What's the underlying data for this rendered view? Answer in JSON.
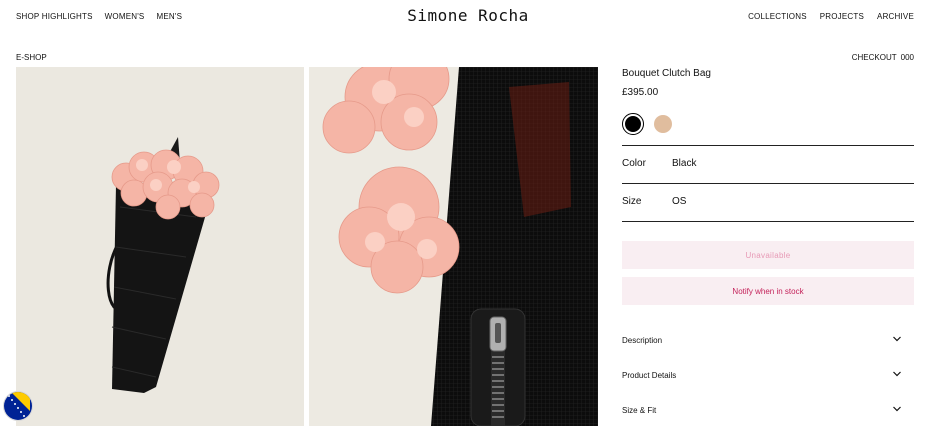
{
  "nav": {
    "left": [
      "SHOP HIGHLIGHTS",
      "WOMEN'S",
      "MEN'S"
    ],
    "brand": "Simone Rocha",
    "right": [
      "COLLECTIONS",
      "PROJECTS",
      "ARCHIVE"
    ]
  },
  "breadcrumb": "E-SHOP",
  "checkout": {
    "label": "CHECKOUT",
    "count": "000"
  },
  "product": {
    "title": "Bouquet Clutch Bag",
    "price": "£395.00",
    "swatches": [
      {
        "name": "Black",
        "color": "#000000",
        "selected": true
      },
      {
        "name": "Nude",
        "color": "#e0bd9e",
        "selected": false
      }
    ],
    "color_label": "Color",
    "color_value": "Black",
    "size_label": "Size",
    "size_value": "OS",
    "unavailable_label": "Unavailable",
    "notify_label": "Notify when in stock",
    "accordions": [
      "Description",
      "Product Details",
      "Size & Fit"
    ]
  },
  "icons": {
    "chevron": "chevron-down-icon",
    "flag": "bosnia-flag-icon"
  }
}
